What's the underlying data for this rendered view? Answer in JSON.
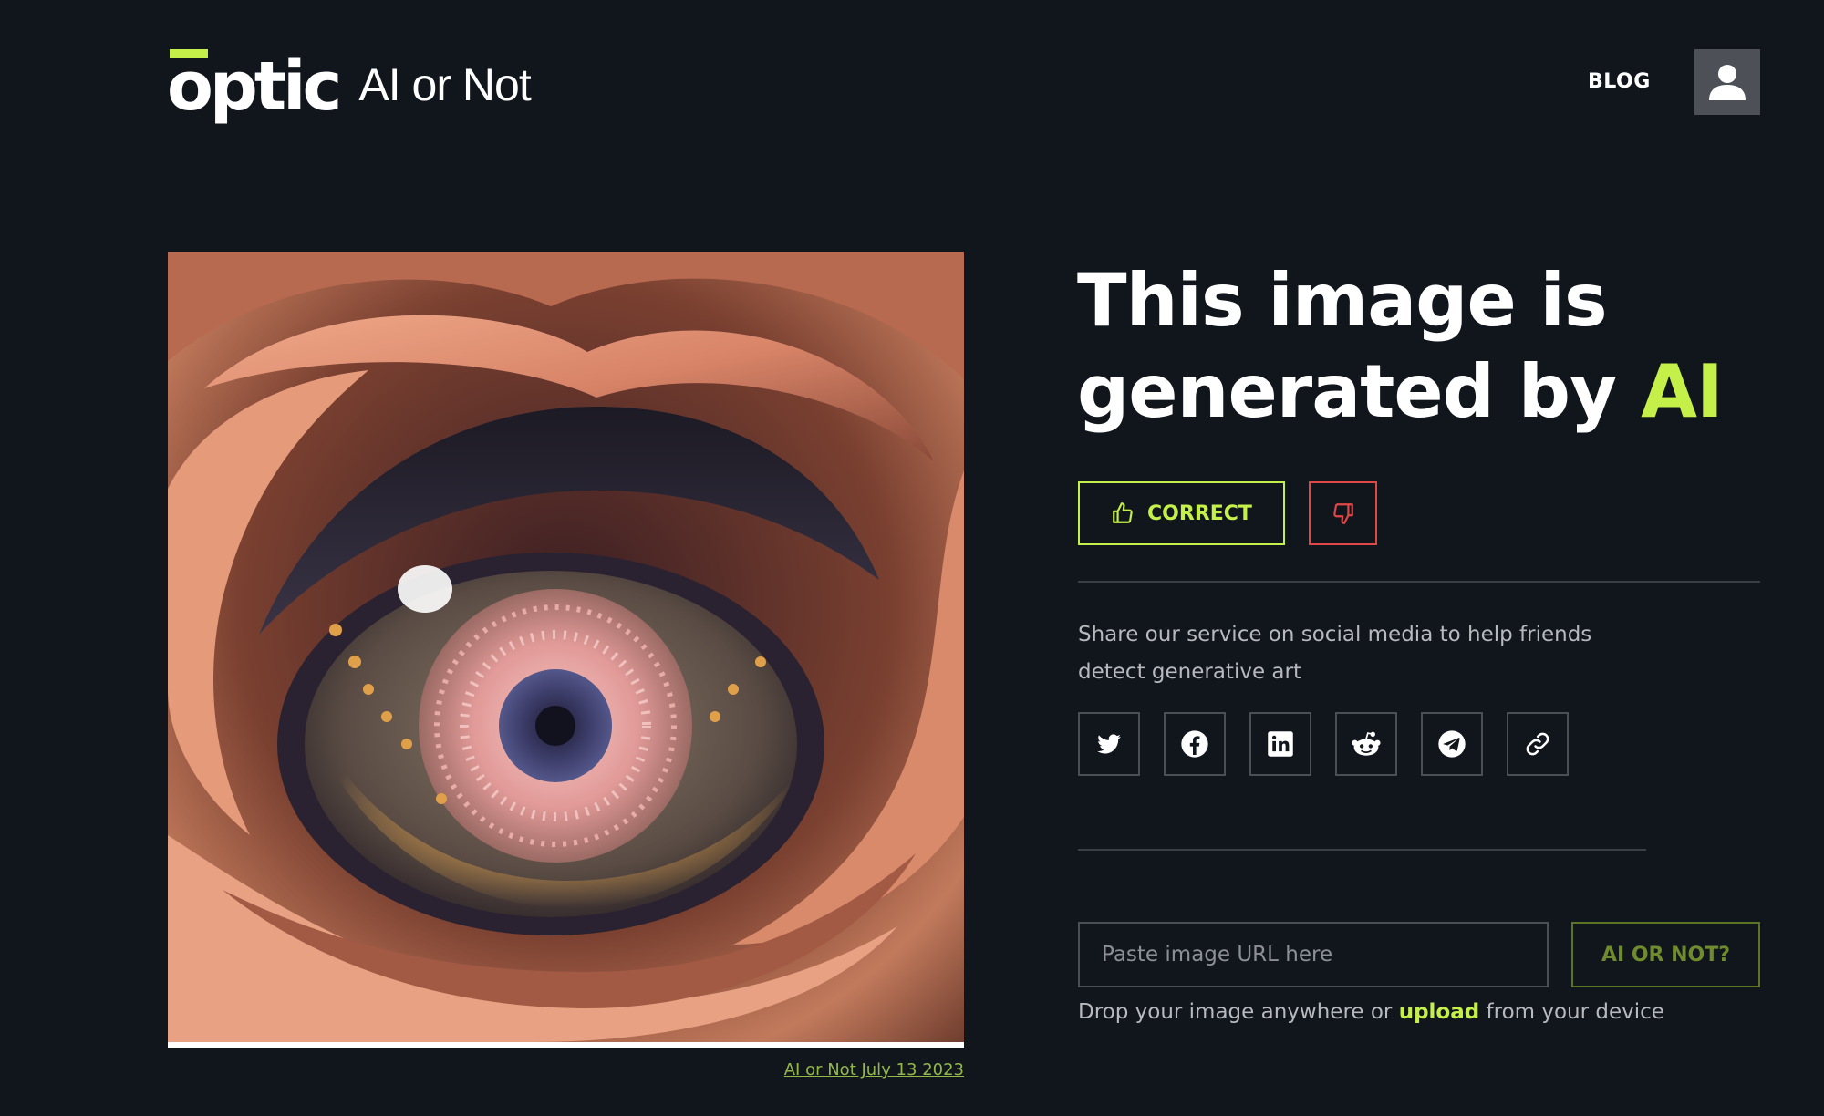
{
  "header": {
    "logo_mark": "optic",
    "logo_product": "AI or Not",
    "blog_label": "BLOG",
    "account_icon": "user-icon"
  },
  "result": {
    "title_prefix": "This image is generated by ",
    "title_highlight": "AI",
    "correct_label": "CORRECT",
    "correct_icon": "thumbs-up-icon",
    "incorrect_icon": "thumbs-down-icon",
    "timestamp_link": "AI or Not July 13 2023"
  },
  "share": {
    "text": "Share our service on social media to help friends detect generative art",
    "buttons": [
      {
        "icon": "twitter-icon"
      },
      {
        "icon": "facebook-icon"
      },
      {
        "icon": "linkedin-icon"
      },
      {
        "icon": "reddit-icon"
      },
      {
        "icon": "telegram-icon"
      },
      {
        "icon": "link-icon"
      }
    ]
  },
  "check": {
    "url_placeholder": "Paste image URL here",
    "submit_label": "AI OR NOT?",
    "drop_prefix": "Drop your image anywhere or ",
    "upload_label": "upload",
    "drop_suffix": " from your device"
  },
  "colors": {
    "background": "#11151c",
    "accent": "#c5f04a",
    "danger": "#e04848",
    "muted_text": "#b6b9bd"
  }
}
